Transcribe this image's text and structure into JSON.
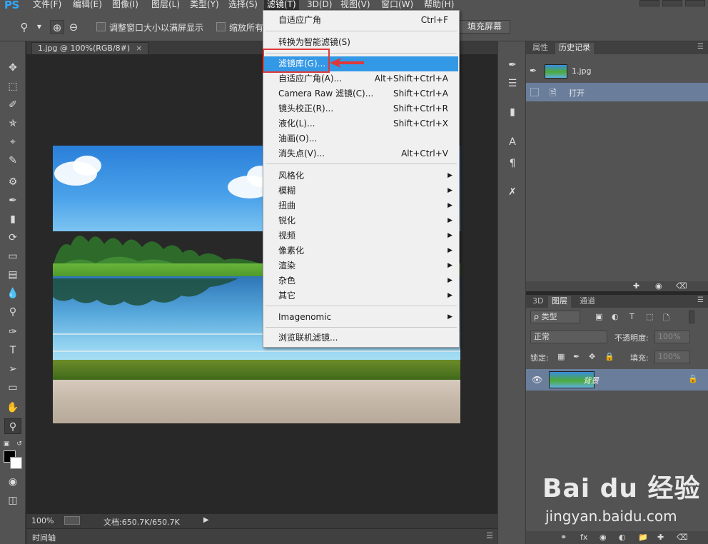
{
  "app": {
    "logo": "PS"
  },
  "menubar": {
    "items": [
      "文件(F)",
      "编辑(E)",
      "图像(I)",
      "图层(L)",
      "类型(Y)",
      "选择(S)",
      "滤镜(T)",
      "3D(D)",
      "视图(V)",
      "窗口(W)",
      "帮助(H)"
    ],
    "active": "滤镜(T)"
  },
  "options": {
    "resize_window_label": "调整窗口大小以满屏显示",
    "zoom_all_label": "缩放所有",
    "fill_screen_button": "填充屏幕"
  },
  "document": {
    "tab_title": "1.jpg @ 100%(RGB/8#)",
    "tab_close": "×",
    "zoom": "100%",
    "doc_size": "文档:650.7K/650.7K",
    "timeline_label": "时间轴"
  },
  "filter_menu": {
    "items": [
      {
        "label": "自适应广角",
        "shortcut": "Ctrl+F"
      },
      {
        "label": "转换为智能滤镜(S)",
        "shortcut": ""
      },
      {
        "label": "滤镜库(G)...",
        "shortcut": "",
        "highlighted": true
      },
      {
        "label": "自适应广角(A)...",
        "shortcut": "Alt+Shift+Ctrl+A"
      },
      {
        "label": "Camera Raw 滤镜(C)...",
        "shortcut": "Shift+Ctrl+A"
      },
      {
        "label": "镜头校正(R)...",
        "shortcut": "Shift+Ctrl+R"
      },
      {
        "label": "液化(L)...",
        "shortcut": "Shift+Ctrl+X"
      },
      {
        "label": "油画(O)...",
        "shortcut": ""
      },
      {
        "label": "消失点(V)...",
        "shortcut": "Alt+Ctrl+V"
      },
      {
        "label": "风格化",
        "submenu": true
      },
      {
        "label": "模糊",
        "submenu": true
      },
      {
        "label": "扭曲",
        "submenu": true
      },
      {
        "label": "锐化",
        "submenu": true
      },
      {
        "label": "视频",
        "submenu": true
      },
      {
        "label": "像素化",
        "submenu": true
      },
      {
        "label": "渲染",
        "submenu": true
      },
      {
        "label": "杂色",
        "submenu": true
      },
      {
        "label": "其它",
        "submenu": true
      },
      {
        "label": "Imagenomic",
        "submenu": true
      },
      {
        "label": "浏览联机滤镜...",
        "shortcut": ""
      }
    ],
    "submenu_glyph": "▶"
  },
  "history_panel": {
    "tabs": [
      "属性",
      "历史记录"
    ],
    "active_tab": "历史记录",
    "snapshot": "1.jpg",
    "steps": [
      "打开"
    ]
  },
  "layers_panel": {
    "tabs": [
      "3D",
      "图层",
      "通道"
    ],
    "active_tab": "图层",
    "filter_kind": "ρ 类型",
    "blend_mode": "正常",
    "opacity_label": "不透明度:",
    "opacity_value": "100%",
    "lock_label": "锁定:",
    "fill_label": "填充:",
    "fill_value": "100%",
    "layers": [
      {
        "name": "背景",
        "locked": true
      }
    ]
  },
  "watermark": {
    "brand": "Bai du 经验",
    "url": "jingyan.baidu.com"
  },
  "colors": {
    "ui_dark": "#535353",
    "canvas_bg": "#282828",
    "menu_bg": "#f0f0f0",
    "menu_highlight": "#3398e6",
    "annotation_red": "#e03838",
    "selection_blue": "#6a7e9c"
  }
}
